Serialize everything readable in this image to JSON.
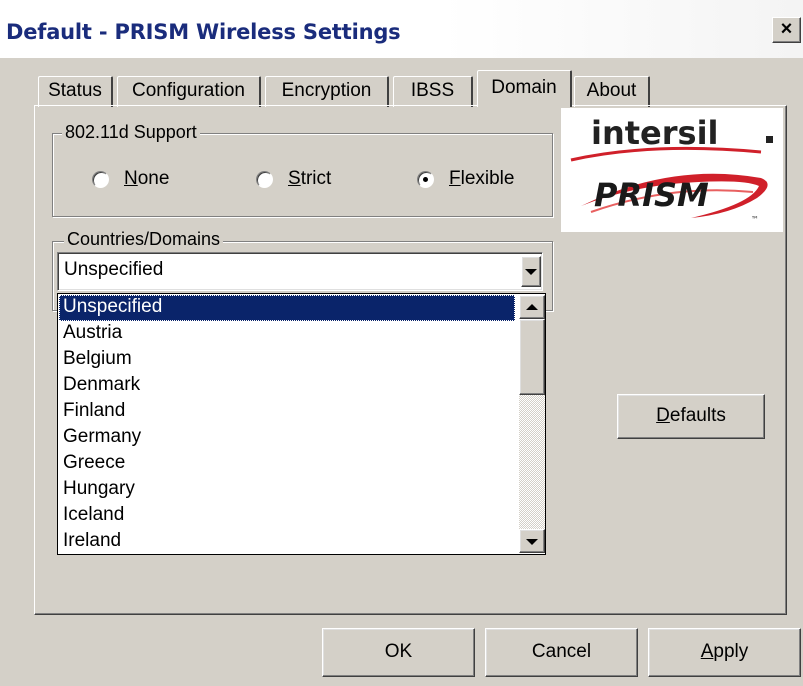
{
  "window": {
    "title": "Default - PRISM Wireless Settings",
    "close_glyph": "×"
  },
  "tabs": [
    {
      "label": "Status"
    },
    {
      "label": "Configuration"
    },
    {
      "label": "Encryption"
    },
    {
      "label": "IBSS"
    },
    {
      "label": "Domain",
      "active": true
    },
    {
      "label": "About"
    }
  ],
  "support_group": {
    "legend": "802.11d Support",
    "options": [
      {
        "label": "None",
        "mnemonic": "N",
        "rest": "one",
        "checked": false
      },
      {
        "label": "Strict",
        "mnemonic": "S",
        "rest": "trict",
        "checked": false
      },
      {
        "label": "Flexible",
        "mnemonic": "F",
        "rest": "lexible",
        "checked": true
      }
    ]
  },
  "logo": {
    "brand_top": "intersil",
    "brand_bottom": "PRISM",
    "tm": "™",
    "colors": {
      "intersil": "#222222",
      "prism": "#1a1a1a",
      "swoosh": "#d0202a"
    }
  },
  "countries": {
    "legend": "Countries/Domains",
    "selected_value": "Unspecified",
    "list_items": [
      "Unspecified",
      "Austria",
      "Belgium",
      "Denmark",
      "Finland",
      "Germany",
      "Greece",
      "Hungary",
      "Iceland",
      "Ireland"
    ],
    "highlighted_index": 0
  },
  "buttons": {
    "defaults": {
      "label": "Defaults",
      "mnemonic": "D",
      "rest": "efaults"
    },
    "ok": {
      "label": "OK"
    },
    "cancel": {
      "label": "Cancel"
    },
    "apply": {
      "label": "Apply",
      "mnemonic": "A",
      "rest": "pply"
    }
  },
  "colors": {
    "face": "#d4d0c8",
    "title_text": "#1a2c7c",
    "highlight": "#0a246a"
  }
}
